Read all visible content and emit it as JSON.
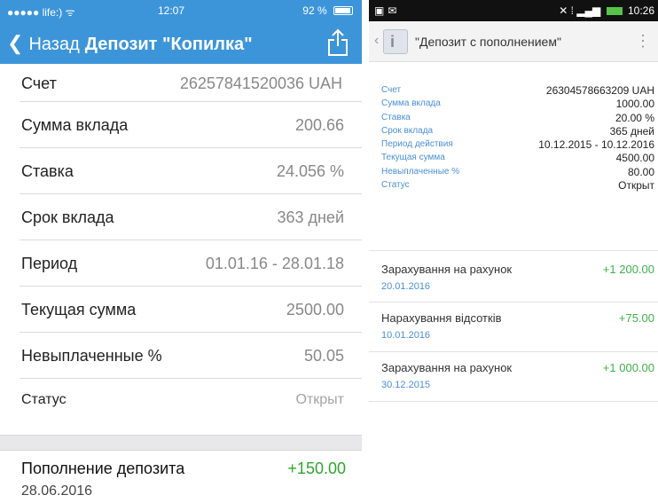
{
  "ios": {
    "status": {
      "carrier": "●●●●● life:) ᯤ",
      "time": "12:07",
      "battery": "92 %"
    },
    "nav": {
      "back_label": "Назад",
      "title": "Депозит \"Копилка\""
    },
    "rows": [
      {
        "label": "Счет",
        "value": "26257841520036 UAH"
      },
      {
        "label": "Сумма вклада",
        "value": "200.66"
      },
      {
        "label": "Ставка",
        "value": "24.056 %"
      },
      {
        "label": "Срок вклада",
        "value": "363 дней"
      },
      {
        "label": "Период",
        "value": "01.01.16 - 28.01.18"
      },
      {
        "label": "Текущая сумма",
        "value": "2500.00"
      },
      {
        "label": "Невыплаченные %",
        "value": "50.05"
      },
      {
        "label": "Статус",
        "value": "Открыт"
      }
    ],
    "transaction": {
      "label": "Пополнение депозита",
      "amount": "+150.00",
      "date": "28.06.2016"
    },
    "colors": {
      "accent": "#3d95d9",
      "positive": "#2ca72c"
    }
  },
  "android": {
    "status": {
      "time": "10:26"
    },
    "title": "\"Депозит с пополнением\"",
    "details": [
      {
        "label": "Счет",
        "value": "26304578663209 UAH"
      },
      {
        "label": "Сумма вклада",
        "value": "1000.00"
      },
      {
        "label": "Ставка",
        "value": "20.00 %"
      },
      {
        "label": "Срок вклада",
        "value": "365 дней"
      },
      {
        "label": "Период действия",
        "value": "10.12.2015 - 10.12.2016"
      },
      {
        "label": "Текущая сумма",
        "value": "4500.00"
      },
      {
        "label": "Невыплаченные %",
        "value": "80.00"
      },
      {
        "label": "Статус",
        "value": "Открыт"
      }
    ],
    "transactions": [
      {
        "label": "Зарахування на рахунок",
        "amount": "+1 200.00",
        "date": "20.01.2016"
      },
      {
        "label": "Нарахування відсотків",
        "amount": "+75.00",
        "date": "10.01.2016"
      },
      {
        "label": "Зарахування на рахунок",
        "amount": "+1 000.00",
        "date": "30.12.2015"
      }
    ],
    "colors": {
      "label": "#4a8fd6",
      "positive": "#3fb14a"
    }
  }
}
